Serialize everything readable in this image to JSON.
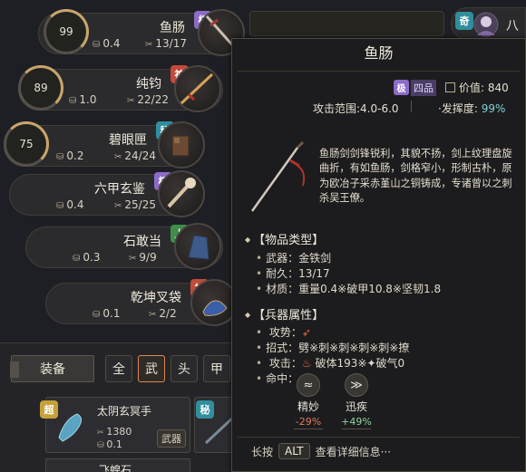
{
  "top": {
    "right_grade": "奇",
    "right_name": "八"
  },
  "items": [
    {
      "durability_ring": "99",
      "name": "鱼肠",
      "grade": "极",
      "weight": "0.4",
      "durability": "13/17"
    },
    {
      "durability_ring": "89",
      "name": "纯钧",
      "grade": "神",
      "weight": "1.0",
      "durability": "22/22"
    },
    {
      "durability_ring": "75",
      "name": "碧眼匣",
      "grade": "秘",
      "weight": "0.2",
      "durability": "24/24"
    },
    {
      "durability_ring": "",
      "name": "六甲玄鉴",
      "grade": "极",
      "weight": "0.4",
      "durability": "25/25"
    },
    {
      "durability_ring": "",
      "name": "石敢当",
      "grade": "上",
      "weight": "0.3",
      "durability": "9/9"
    },
    {
      "durability_ring": "",
      "name": "乾坤叉袋",
      "grade": "神",
      "weight": "0.1",
      "durability": "2/2"
    }
  ],
  "equip": {
    "label": "装备",
    "tabs": [
      "全",
      "武",
      "头",
      "甲"
    ],
    "active_tab": "武",
    "card": {
      "grade": "超",
      "name": "太阴玄冥手",
      "durability": "1380",
      "weight": "0.1",
      "type": "武器"
    },
    "card2_grade": "秘",
    "next_name": "飞蝗石"
  },
  "tooltip": {
    "title": "鱼肠",
    "grade_badge": "极",
    "grade_text": "四品",
    "price_label": "价值:",
    "price": "840",
    "range_label": "攻击范围:",
    "range": "4.0-6.0",
    "fa_label": "·发挥度:",
    "fa": "99%",
    "description": "鱼肠剑剑锋锐利，其貌不扬，剑上纹理盘旋曲折，有如鱼肠，剑格窄小，形制古朴，原为欧冶子采赤堇山之铜铸成，专诸曾以之刺杀吴王僚。",
    "sec1": "【物品类型】",
    "weapon_line": "武器：金铁剑",
    "durability_line": "耐久：13/17",
    "material_line": "材质：重量0.4※破甲10.8※坚韧1.8",
    "sec2": "【兵器属性】",
    "attack_pose_label": "攻势：",
    "moves_line": "招式：劈※刺※刺※刺※刺※撩",
    "attack_label": "攻击：",
    "attack_a": "破体193※",
    "attack_b": "破气0",
    "hit_label": "命中：",
    "skills": [
      {
        "icon": "ac",
        "name": "精妙",
        "value": "-29%"
      },
      {
        "icon": "sp",
        "name": "迅疾",
        "value": "+49%"
      }
    ],
    "hint_prefix": "长按",
    "hint_key": "ALT",
    "hint_text": "查看详细信息···"
  },
  "colors": {
    "background": "#1e1f24",
    "grade_ji": "#8d6bc8",
    "grade_shen": "#c24a3a",
    "grade_shang": "#3e8f49",
    "grade_mi": "#2f8f9e",
    "grade_chao": "#c6a13a",
    "active_tab": "#d98a4e",
    "fa_value": "#7fd1d6",
    "negative": "#e27a5a",
    "positive": "#8fd39a"
  }
}
